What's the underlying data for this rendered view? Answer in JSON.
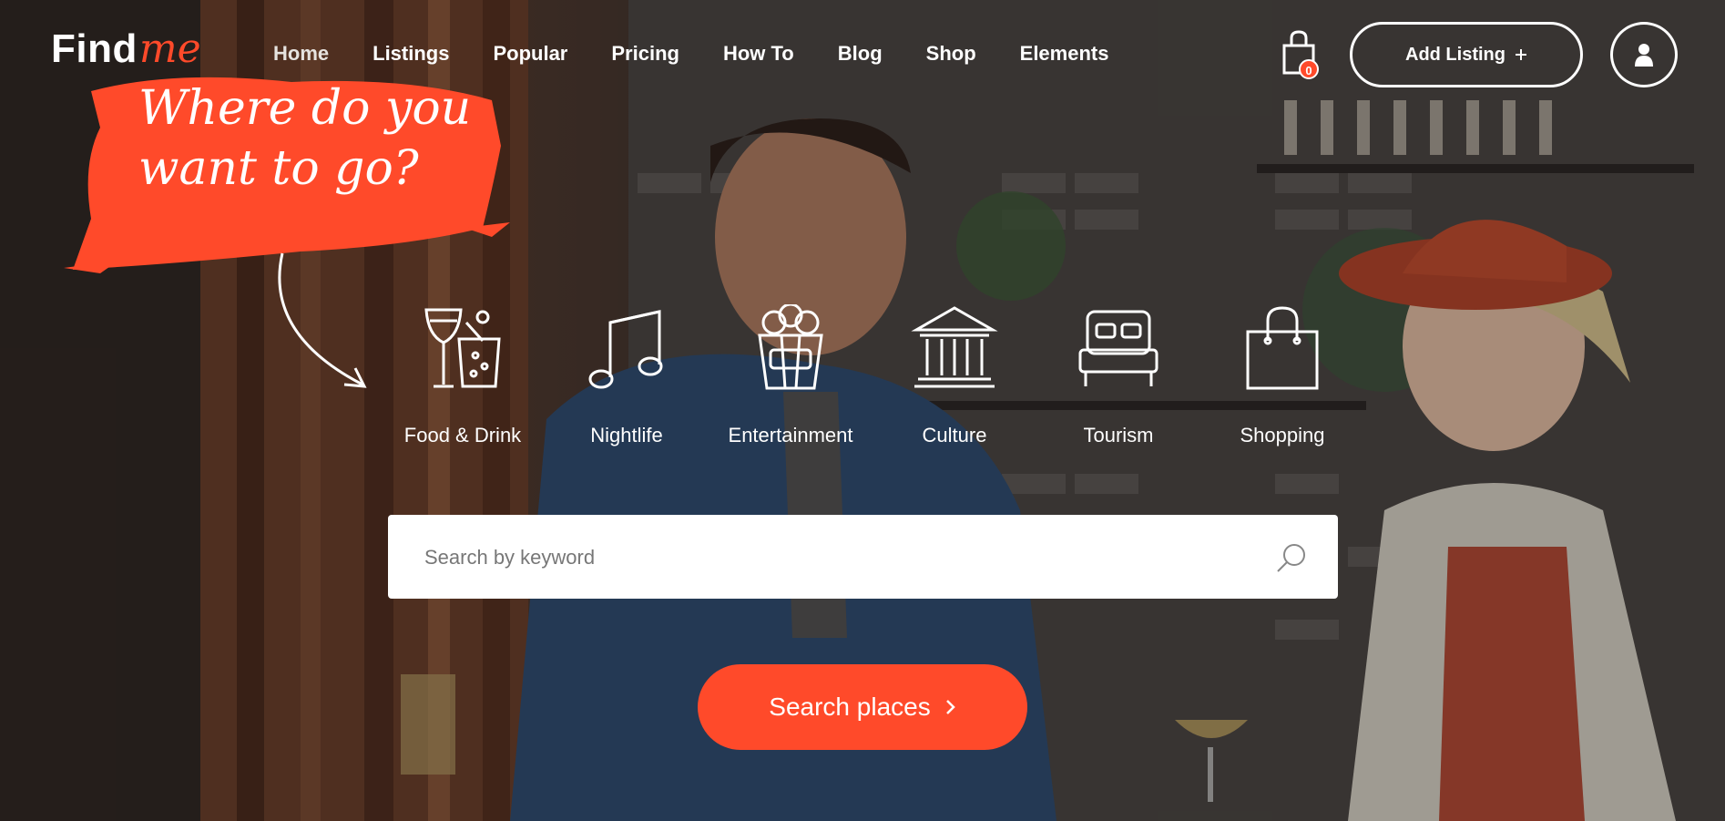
{
  "logo": {
    "find": "Find",
    "me": "me"
  },
  "nav": [
    {
      "label": "Home",
      "active": true
    },
    {
      "label": "Listings"
    },
    {
      "label": "Popular"
    },
    {
      "label": "Pricing"
    },
    {
      "label": "How To"
    },
    {
      "label": "Blog"
    },
    {
      "label": "Shop"
    },
    {
      "label": "Elements"
    }
  ],
  "cart": {
    "count": "0",
    "icon": "shopping-bag-icon"
  },
  "add_listing": {
    "label": "Add Listing",
    "icon": "plus-icon"
  },
  "user": {
    "icon": "user-icon"
  },
  "headline": {
    "line1": "Where do you",
    "line2": "want to go?"
  },
  "categories": [
    {
      "label": "Food & Drink",
      "icon": "cocktail-icon"
    },
    {
      "label": "Nightlife",
      "icon": "music-note-icon"
    },
    {
      "label": "Entertainment",
      "icon": "popcorn-icon"
    },
    {
      "label": "Culture",
      "icon": "museum-icon"
    },
    {
      "label": "Tourism",
      "icon": "bed-icon"
    },
    {
      "label": "Shopping",
      "icon": "shopping-bag-icon"
    }
  ],
  "search": {
    "placeholder": "Search by keyword",
    "icon": "search-icon"
  },
  "search_button": {
    "label": "Search places",
    "icon": "chevron-right-icon"
  },
  "colors": {
    "accent": "#ff4a2a",
    "text": "#ffffff"
  }
}
